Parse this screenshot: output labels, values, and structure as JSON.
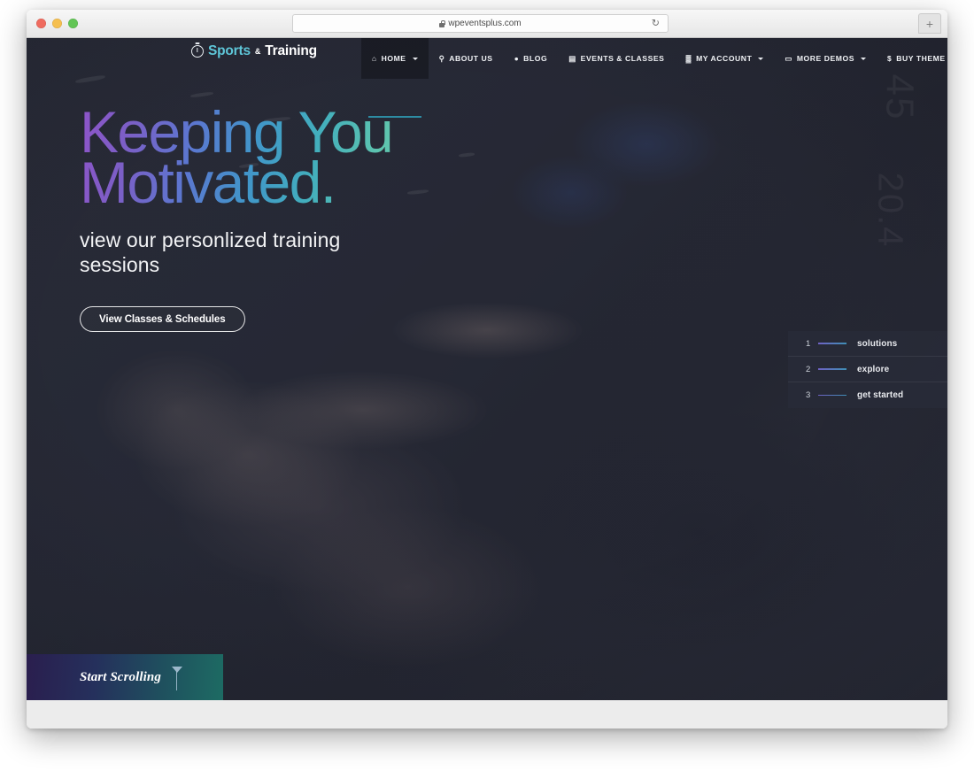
{
  "browser": {
    "url": "wpeventsplus.com",
    "lock_icon": "lock-icon",
    "reload_icon": "↻",
    "newtab_label": "+",
    "traffic_lights": [
      "close",
      "minimize",
      "maximize"
    ]
  },
  "header": {
    "logo": {
      "icon": "stopwatch-icon",
      "part1": "Sports",
      "amp": "&",
      "part2": "Training",
      "accent_color": "#5ec6d8"
    },
    "nav": [
      {
        "label": "HOME",
        "icon": "home-icon",
        "glyph": "⌂",
        "caret": true,
        "active": true
      },
      {
        "label": "ABOUT US",
        "icon": "map-pin-icon",
        "glyph": "⚲",
        "caret": false,
        "active": false
      },
      {
        "label": "BLOG",
        "icon": "chat-bubble-icon",
        "glyph": "●",
        "caret": false,
        "active": false
      },
      {
        "label": "EVENTS & CLASSES",
        "icon": "calendar-icon",
        "glyph": "▤",
        "caret": false,
        "active": false
      },
      {
        "label": "MY ACCOUNT",
        "icon": "users-icon",
        "glyph": "▓",
        "caret": true,
        "active": false
      },
      {
        "label": "MORE DEMOS",
        "icon": "monitor-icon",
        "glyph": "▭",
        "caret": true,
        "active": false
      },
      {
        "label": "BUY THEME",
        "icon": "dollar-icon",
        "glyph": "$",
        "caret": false,
        "active": false
      }
    ],
    "active_underline_color": "#2d8ca3"
  },
  "hero": {
    "headline": "Keeping You\nMotivated.",
    "headline_gradient_from": "#8e54c8",
    "headline_gradient_to": "#5ec4ae",
    "subheadline": "view our personlized training sessions",
    "cta_label": "View Classes & Schedules",
    "background_numbers": [
      "45",
      "20.4"
    ]
  },
  "slider_nav": {
    "slides": [
      {
        "number": "1",
        "label": "solutions"
      },
      {
        "number": "2",
        "label": "explore"
      },
      {
        "number": "3",
        "label": "get started"
      }
    ]
  },
  "scroll_prompt": {
    "label": "Start Scrolling",
    "arrow_icon": "arrow-down-icon",
    "gradient_from": "#2a1e4e",
    "gradient_to": "#1d6b63"
  }
}
